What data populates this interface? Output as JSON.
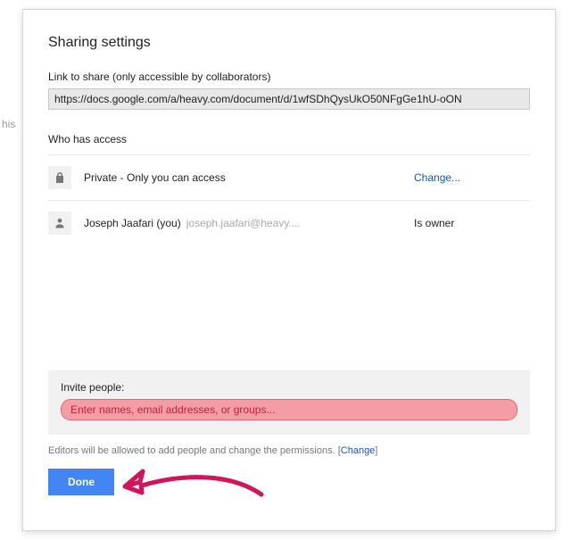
{
  "backdrop_hint": "his",
  "dialog": {
    "title": "Sharing settings",
    "link_label": "Link to share (only accessible by collaborators)",
    "link_value": "https://docs.google.com/a/heavy.com/document/d/1wfSDhQysUkO50NFgGe1hU-oON",
    "access_header": "Who has access",
    "rows": [
      {
        "icon": "lock-icon",
        "text": "Private - Only you can access",
        "email": "",
        "right_label": "Change...",
        "right_kind": "link"
      },
      {
        "icon": "person-icon",
        "text": "Joseph Jaafari (you)",
        "email": "joseph.jaafari@heavy....",
        "right_label": "Is owner",
        "right_kind": "text"
      }
    ],
    "invite": {
      "label": "Invite people:",
      "placeholder": "Enter names, email addresses, or groups..."
    },
    "perm_note_prefix": "Editors will be allowed to add people and change the permissions.  [",
    "perm_note_link": "Change",
    "perm_note_suffix": "]",
    "done_label": "Done"
  }
}
